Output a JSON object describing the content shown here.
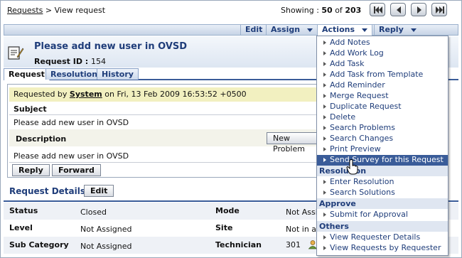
{
  "breadcrumb": {
    "root": "Requests",
    "separator": " > ",
    "current": "View request"
  },
  "pager": {
    "showing_label": "Showing : ",
    "range": "50",
    "of": " of ",
    "total": "203"
  },
  "toolbar": {
    "edit": "Edit",
    "assign": "Assign",
    "actions": "Actions",
    "reply": "Reply"
  },
  "header": {
    "title": "Please add new user in OVSD",
    "request_id_label": "Request ID : ",
    "request_id": "154"
  },
  "tabs": [
    "Request",
    "Resolution",
    "History"
  ],
  "request": {
    "requested_by_prefix": "Requested by ",
    "requester": "System",
    "requested_on": " on Fri, 13 Feb 2009 16:53:52 +0500",
    "subject_label": "Subject",
    "subject": "Please add new user in OVSD",
    "description_label": "Description",
    "description_toggle": "New Problem",
    "description": "Please add new user in OVSD",
    "reply_button": "Reply",
    "forward_button": "Forward"
  },
  "details": {
    "title": "Request Details",
    "edit_button": "Edit",
    "rows": [
      {
        "label": "Status",
        "value": "Closed",
        "label2": "Mode",
        "value2": "Not Assig"
      },
      {
        "label": "Level",
        "value": "Not Assigned",
        "label2": "Site",
        "value2": "Not in an"
      },
      {
        "label": "Sub Category",
        "value": "Not Assigned",
        "label2": "Technician",
        "value2": "301"
      }
    ]
  },
  "actions_menu": {
    "items": [
      "Add Notes",
      "Add Work Log",
      "Add Task",
      "Add Task from Template",
      "Add Reminder",
      "Merge Request",
      "Duplicate Request",
      "Delete",
      "Search Problems",
      "Search Changes",
      "Print Preview",
      "Send Survey for this Request"
    ],
    "resolution_header": "Resolution",
    "resolution_items": [
      "Enter Resolution",
      "Search Solutions"
    ],
    "approve_header": "Approve",
    "approve_items": [
      "Submit for Approval"
    ],
    "others_header": "Others",
    "others_items": [
      "View Requester Details",
      "View Requests by Requester"
    ]
  },
  "icons": {
    "first": "first-page-icon",
    "prev": "previous-page-icon",
    "next": "next-page-icon",
    "last": "last-page-icon",
    "note": "note-icon",
    "cursor": "hand-cursor-icon",
    "technician": "user-icon"
  },
  "colors": {
    "accent": "#1f3d7a",
    "highlight": "#3a5c99",
    "requested_bar": "#f2f0c0"
  }
}
